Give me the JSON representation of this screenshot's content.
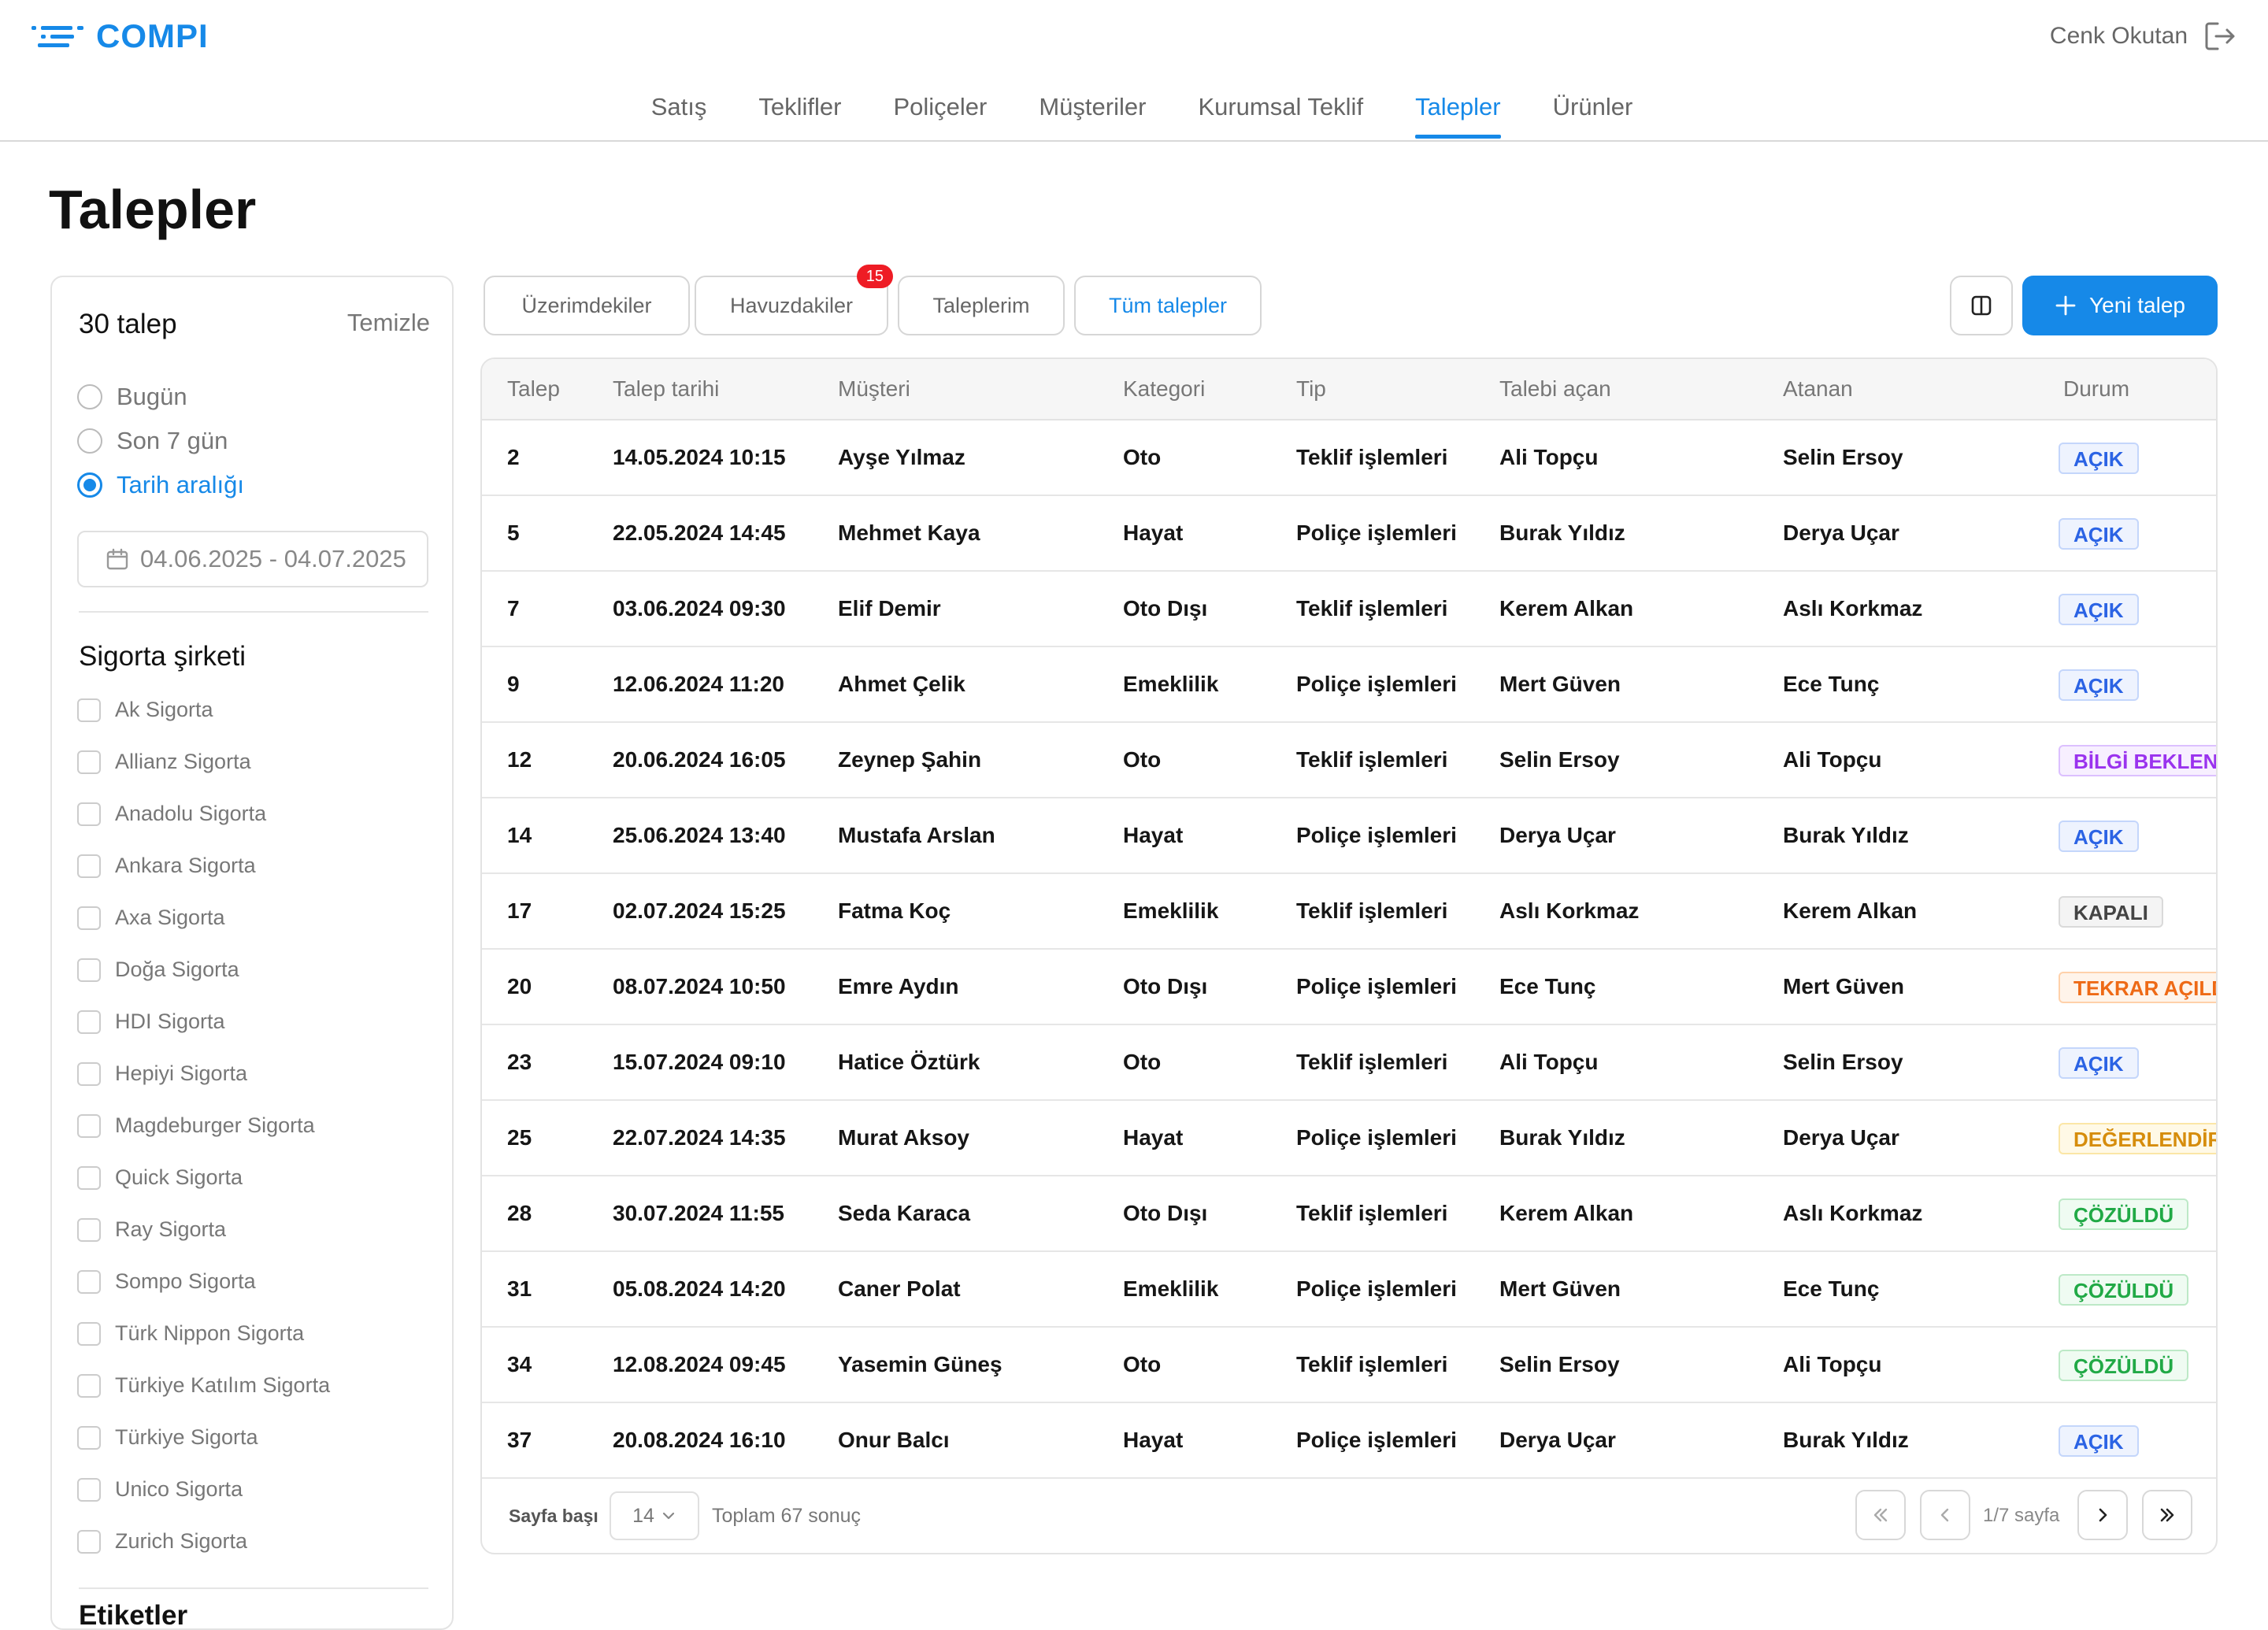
{
  "app": {
    "brand": "COMPI",
    "user_name": "Cenk Okutan"
  },
  "nav": {
    "tabs": [
      {
        "label": "Satış"
      },
      {
        "label": "Teklifler"
      },
      {
        "label": "Poliçeler"
      },
      {
        "label": "Müşteriler"
      },
      {
        "label": "Kurumsal Teklif"
      },
      {
        "label": "Talepler",
        "active": true
      },
      {
        "label": "Ürünler"
      }
    ]
  },
  "page_title": "Talepler",
  "sidebar": {
    "count": "30 talep",
    "clear": "Temizle",
    "date_filters": [
      {
        "label": "Bugün",
        "checked": false
      },
      {
        "label": "Son 7 gün",
        "checked": false
      },
      {
        "label": "Tarih aralığı",
        "checked": true
      }
    ],
    "date_range": "04.06.2025 - 04.07.2025",
    "insurer_heading": "Sigorta şirketi",
    "insurers": [
      "Ak Sigorta",
      "Allianz Sigorta",
      "Anadolu Sigorta",
      "Ankara Sigorta",
      "Axa Sigorta",
      "Doğa Sigorta",
      "HDI Sigorta",
      "Hepiyi Sigorta",
      "Magdeburger Sigorta",
      "Quick Sigorta",
      "Ray Sigorta",
      "Sompo Sigorta",
      "Türk Nippon Sigorta",
      "Türkiye Katılım Sigorta",
      "Türkiye Sigorta",
      "Unico Sigorta",
      "Zurich Sigorta"
    ],
    "next_heading": "Etiketler"
  },
  "filters": {
    "tabs": [
      {
        "label": "Üzerimdekiler"
      },
      {
        "label": "Havuzdakiler",
        "badge": "15"
      },
      {
        "label": "Taleplerim"
      },
      {
        "label": "Tüm talepler",
        "active": true
      }
    ],
    "new_button": "Yeni talep"
  },
  "table": {
    "columns": [
      "Talep",
      "Talep tarihi",
      "Müşteri",
      "Kategori",
      "Tip",
      "Talebi açan",
      "Atanan",
      "Durum"
    ],
    "rows": [
      [
        "2",
        "14.05.2024 10:15",
        "Ayşe Yılmaz",
        "Oto",
        "Teklif işlemleri",
        "Ali Topçu",
        "Selin Ersoy",
        "AÇIK"
      ],
      [
        "5",
        "22.05.2024 14:45",
        "Mehmet Kaya",
        "Hayat",
        "Poliçe işlemleri",
        "Burak Yıldız",
        "Derya Uçar",
        "AÇIK"
      ],
      [
        "7",
        "03.06.2024 09:30",
        "Elif Demir",
        "Oto Dışı",
        "Teklif işlemleri",
        "Kerem Alkan",
        "Aslı Korkmaz",
        "AÇIK"
      ],
      [
        "9",
        "12.06.2024 11:20",
        "Ahmet Çelik",
        "Emeklilik",
        "Poliçe işlemleri",
        "Mert Güven",
        "Ece Tunç",
        "AÇIK"
      ],
      [
        "12",
        "20.06.2024 16:05",
        "Zeynep Şahin",
        "Oto",
        "Teklif işlemleri",
        "Selin Ersoy",
        "Ali Topçu",
        "BİLGİ BEKLENİ"
      ],
      [
        "14",
        "25.06.2024 13:40",
        "Mustafa Arslan",
        "Hayat",
        "Poliçe işlemleri",
        "Derya Uçar",
        "Burak Yıldız",
        "AÇIK"
      ],
      [
        "17",
        "02.07.2024 15:25",
        "Fatma Koç",
        "Emeklilik",
        "Teklif işlemleri",
        "Aslı Korkmaz",
        "Kerem Alkan",
        "KAPALI"
      ],
      [
        "20",
        "08.07.2024 10:50",
        "Emre Aydın",
        "Oto Dışı",
        "Poliçe işlemleri",
        "Ece Tunç",
        "Mert Güven",
        "TEKRAR AÇILD"
      ],
      [
        "23",
        "15.07.2024 09:10",
        "Hatice Öztürk",
        "Oto",
        "Teklif işlemleri",
        "Ali Topçu",
        "Selin Ersoy",
        "AÇIK"
      ],
      [
        "25",
        "22.07.2024 14:35",
        "Murat Aksoy",
        "Hayat",
        "Poliçe işlemleri",
        "Burak Yıldız",
        "Derya Uçar",
        "DEĞERLENDİR"
      ],
      [
        "28",
        "30.07.2024 11:55",
        "Seda Karaca",
        "Oto Dışı",
        "Teklif işlemleri",
        "Kerem Alkan",
        "Aslı Korkmaz",
        "ÇÖZÜLDÜ"
      ],
      [
        "31",
        "05.08.2024 14:20",
        "Caner Polat",
        "Emeklilik",
        "Poliçe işlemleri",
        "Mert Güven",
        "Ece Tunç",
        "ÇÖZÜLDÜ"
      ],
      [
        "34",
        "12.08.2024 09:45",
        "Yasemin Güneş",
        "Oto",
        "Teklif işlemleri",
        "Selin Ersoy",
        "Ali Topçu",
        "ÇÖZÜLDÜ"
      ],
      [
        "37",
        "20.08.2024 16:10",
        "Onur Balcı",
        "Hayat",
        "Poliçe işlemleri",
        "Derya Uçar",
        "Burak Yıldız",
        "AÇIK"
      ]
    ],
    "status_styles": {
      "AÇIK": "st-open",
      "BİLGİ BEKLENİ": "st-info",
      "KAPALI": "st-closed",
      "TEKRAR AÇILD": "st-reopen",
      "DEĞERLENDİR": "st-eval",
      "ÇÖZÜLDÜ": "st-resolved"
    }
  },
  "pagination": {
    "per_page_label": "Sayfa başı",
    "per_page_value": "14",
    "total": "Toplam 67 sonuç",
    "page_info": "1/7 sayfa"
  },
  "colors": {
    "accent": "#1689e8",
    "badge": "#ee1c25"
  }
}
